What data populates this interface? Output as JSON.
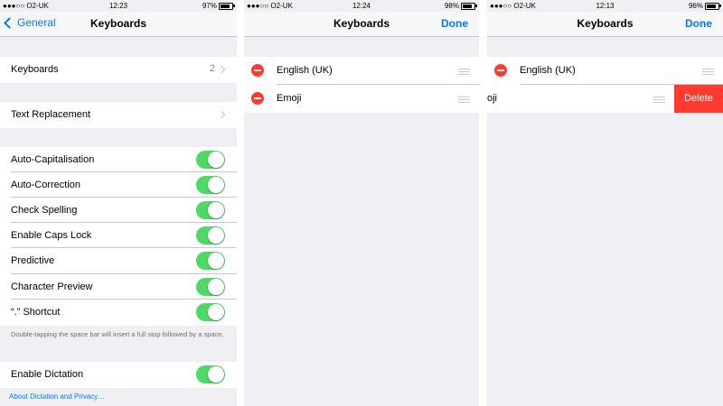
{
  "panel1": {
    "status": {
      "carrier": "●●●○○ O2-UK",
      "time": "12:23",
      "battery": "97%"
    },
    "nav": {
      "back": "General",
      "title": "Keyboards"
    },
    "keyboards_row": {
      "label": "Keyboards",
      "count": "2"
    },
    "text_replacement": {
      "label": "Text Replacement"
    },
    "toggles": [
      {
        "label": "Auto-Capitalisation",
        "on": true
      },
      {
        "label": "Auto-Correction",
        "on": true
      },
      {
        "label": "Check Spelling",
        "on": true
      },
      {
        "label": "Enable Caps Lock",
        "on": true
      },
      {
        "label": "Predictive",
        "on": true
      },
      {
        "label": "Character Preview",
        "on": true
      },
      {
        "label": "“.” Shortcut",
        "on": true
      }
    ],
    "shortcut_note": "Double-tapping the space bar will insert a full stop followed by a space.",
    "dictation": {
      "label": "Enable Dictation",
      "on": true
    },
    "dictation_link": "About Dictation and Privacy…"
  },
  "panel2": {
    "status": {
      "carrier": "●●●○○ O2-UK",
      "time": "12:24",
      "battery": "98%"
    },
    "nav": {
      "title": "Keyboards",
      "done": "Done"
    },
    "keyboards": [
      "English (UK)",
      "Emoji"
    ]
  },
  "panel3": {
    "status": {
      "carrier": "●●●○○ O2-UK",
      "time": "12:13",
      "battery": "96%"
    },
    "nav": {
      "title": "Keyboards",
      "done": "Done"
    },
    "keyboards": [
      "English (UK)",
      "oji"
    ],
    "delete_label": "Delete"
  },
  "colors": {
    "accent": "#007aff",
    "toggle_on": "#4cd964",
    "destructive": "#ff3b30"
  }
}
